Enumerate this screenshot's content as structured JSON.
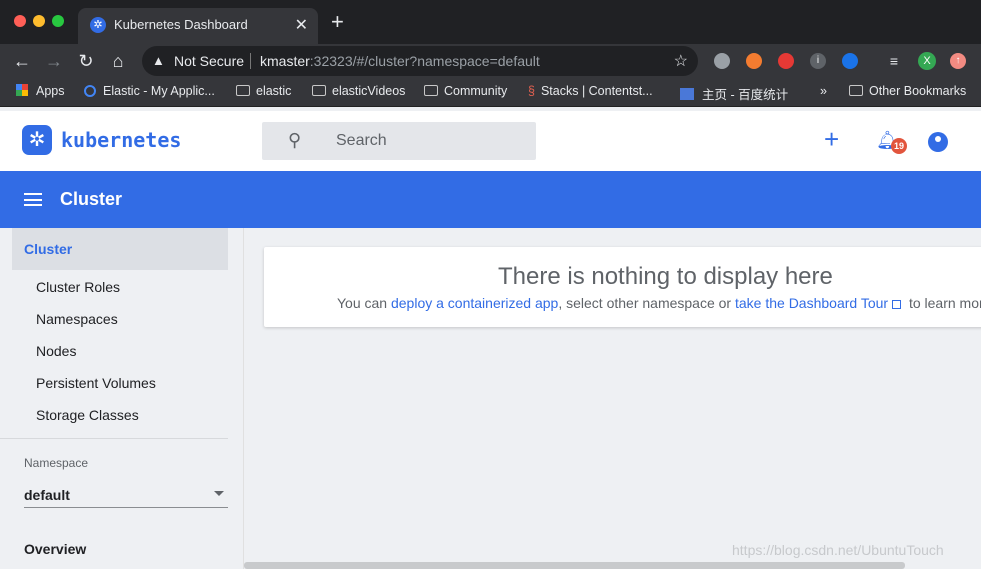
{
  "browser": {
    "tab_title": "Kubernetes Dashboard",
    "tab_close": "✕",
    "new_tab": "+",
    "address": {
      "security_label": "Not Secure",
      "host": "kmaster",
      "path": ":32323/#/cluster?namespace=default"
    },
    "bookmarks": [
      "Apps",
      "Elastic - My Applic...",
      "elastic",
      "elasticVideos",
      "Community",
      "Stacks | Contentst...",
      "主页 - 百度统计",
      "»",
      "Other Bookmarks"
    ]
  },
  "app": {
    "logo_text": "kubernetes",
    "search_placeholder": "Search",
    "notification_count": "19",
    "page_title": "Cluster"
  },
  "sidebar": {
    "active_item": "Cluster",
    "items": [
      "Cluster Roles",
      "Namespaces",
      "Nodes",
      "Persistent Volumes",
      "Storage Classes"
    ],
    "namespace_label": "Namespace",
    "namespace_value": "default",
    "overview": "Overview"
  },
  "main": {
    "empty_title": "There is nothing to display here",
    "empty_text_1": "You can ",
    "empty_link_1": "deploy a containerized app",
    "empty_text_2": ", select other namespace or ",
    "empty_link_2": "take the Dashboard Tour",
    "empty_text_3": " to learn more"
  },
  "watermark": "https://blog.csdn.net/UbuntuTouch",
  "colors": {
    "accent": "#326ce5",
    "badge": "#e2553d"
  }
}
